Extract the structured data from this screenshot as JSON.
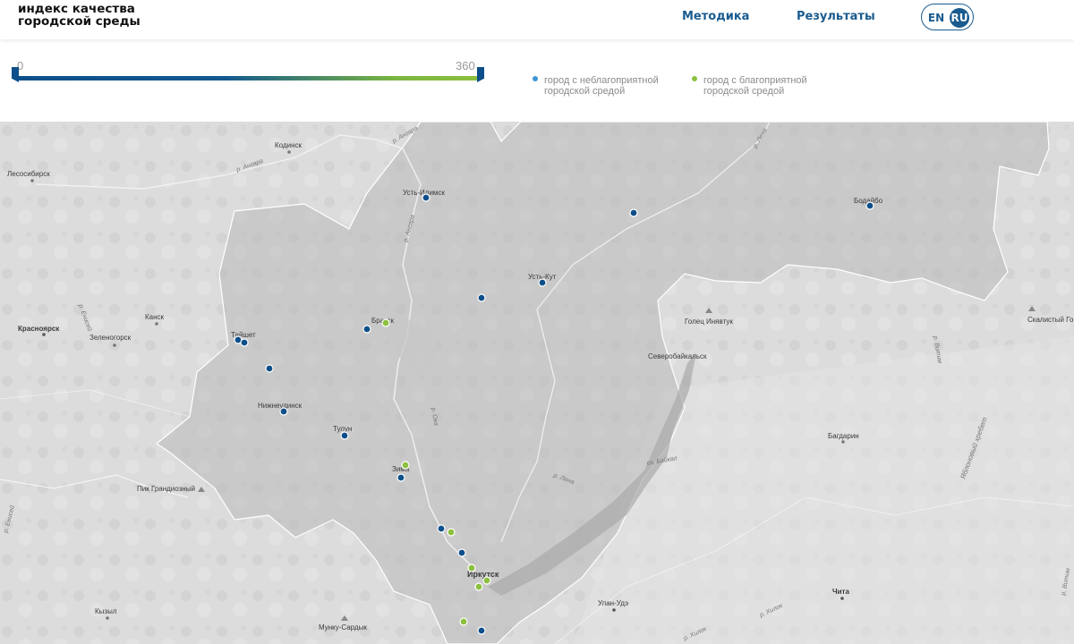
{
  "header": {
    "logo_line1": "индекс качества",
    "logo_line2": "городской среды",
    "nav": {
      "method": "Методика",
      "results": "Результаты"
    },
    "lang": {
      "en": "EN",
      "ru": "RU",
      "active": "RU"
    }
  },
  "legend": {
    "scale_min": "0",
    "scale_max": "360",
    "bad_label": "город с неблагоприятной городской средой",
    "good_label": "город с благоприятной городской средой",
    "colors": {
      "bad": "#0d4f8a",
      "good": "#8cc03e",
      "gradient_start": "#0d4f8a",
      "gradient_end": "#8cc03e"
    }
  },
  "map": {
    "city_labels": {
      "kodinsk": "Кодинск",
      "lesosibirsk": "Лесосибирск",
      "ust_ilimsk": "Усть-Илимск",
      "bodaibo": "Бодайбо",
      "ust_kut": "Усть-Кут",
      "kansk": "Канск",
      "krasnoyarsk": "Красноярск",
      "zelenogorsk": "Зеленогорск",
      "taishet": "Тайшет",
      "bratsk": "Братск",
      "nizhneudinsk": "Нижнеудинск",
      "tulun": "Тулун",
      "zima": "Зима",
      "severobaikalsk": "Северобайкальск",
      "golets": "Голец Инявтук",
      "skalisty": "Скалистый Го",
      "bagdarin": "Багдарин",
      "pik": "Пик Грандиозный",
      "irkutsk": "Иркутск",
      "ulan_ude": "Улан-Удэ",
      "chita": "Чита",
      "kyzyl": "Кызыл",
      "munku": "Мунку-Сардык"
    },
    "feature_labels": {
      "angara1": "р. Ангара",
      "angara2": "р. Ангара",
      "angara3": "р. Ангара",
      "lena_n": "р. Лена",
      "lena": "р. Лена",
      "yenisei": "р. Енисей",
      "yenisei2": "р. Енисей",
      "baikal": "оз. Байкал",
      "yablonovy": "Яблоновый хребет",
      "khilok": "р. Хилок",
      "khilok2": "р. Хилок",
      "vitim": "р. Витим",
      "vitim2": "р. Витим",
      "oka": "р. Ока"
    }
  }
}
